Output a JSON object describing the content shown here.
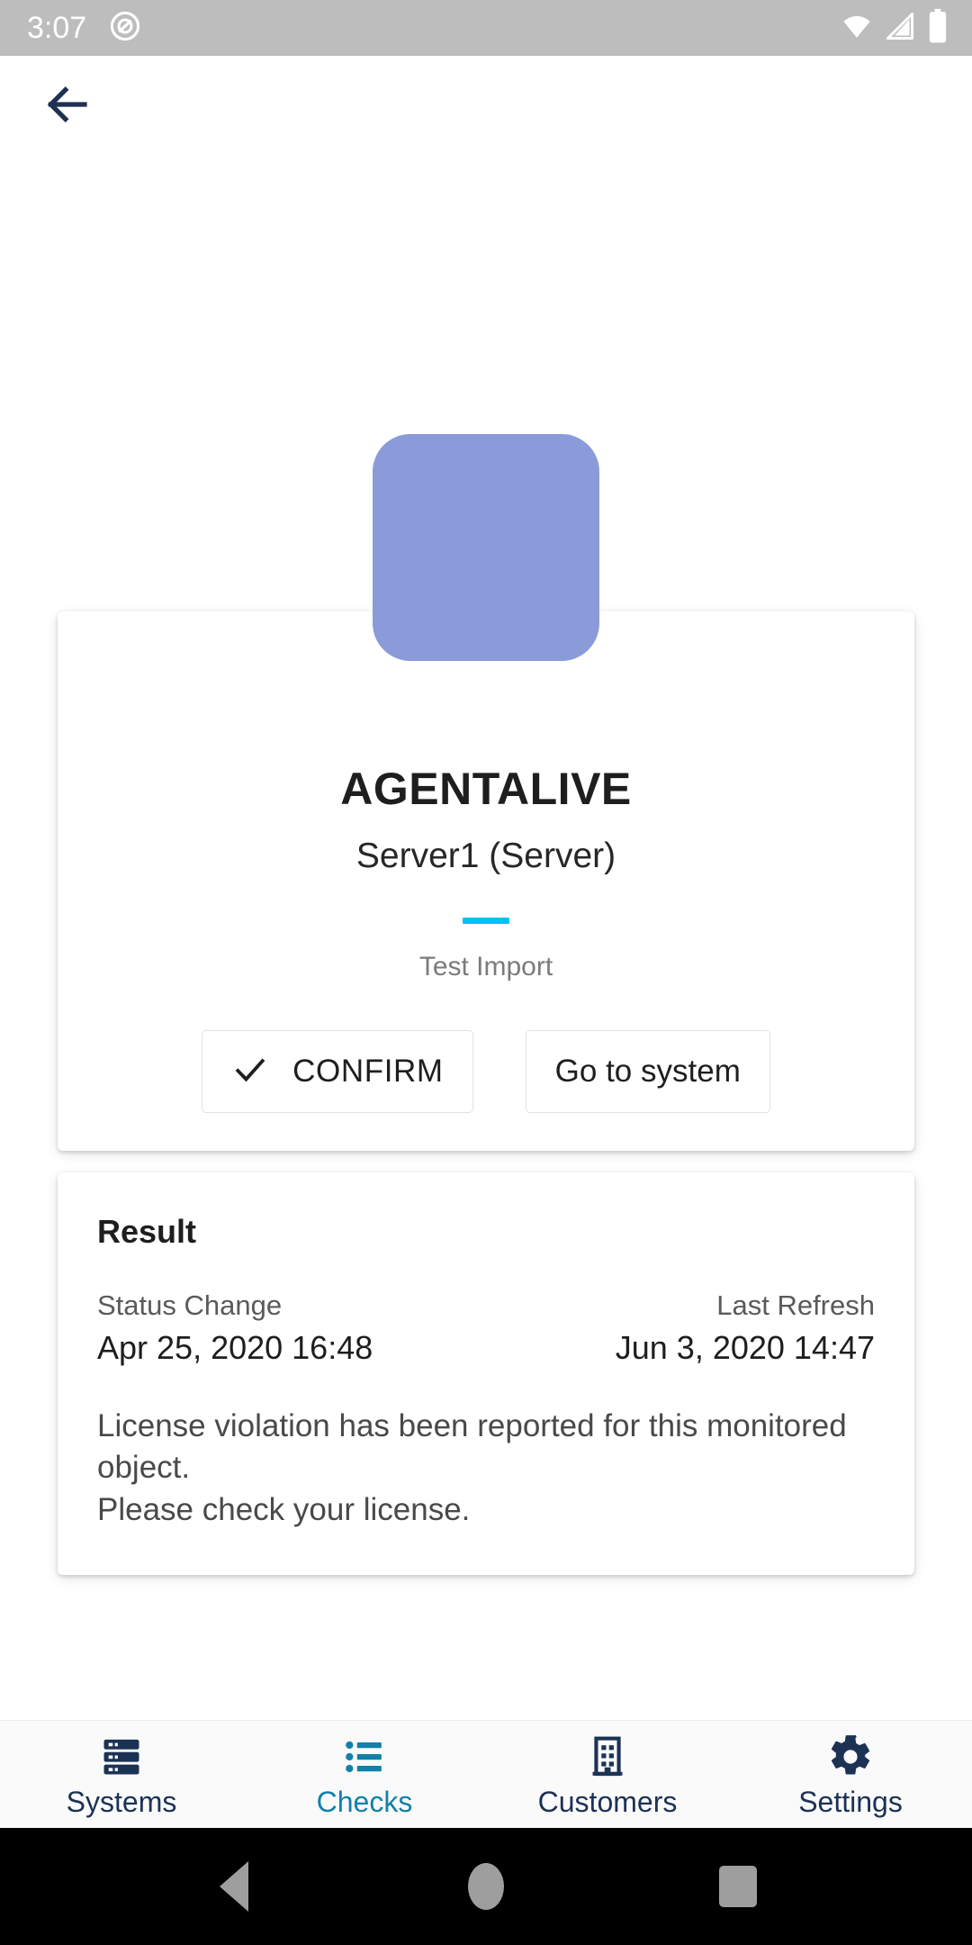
{
  "status_bar": {
    "time": "3:07",
    "icons": [
      "notification-circle-icon",
      "wifi-icon",
      "cellular-signal-icon",
      "battery-icon"
    ],
    "background_color": "#bdbdbd"
  },
  "app_bar": {
    "back_icon": "arrow-left-icon",
    "icon_color": "#1f3051"
  },
  "detail": {
    "avatar_color": "#8b9bd9",
    "system_title": "AGENTALIVE",
    "system_subtitle": "Server1 (Server)",
    "accent_color": "#00c3f0",
    "check_name": "Test Import",
    "buttons": {
      "confirm_label": "CONFIRM",
      "confirm_icon": "check-icon",
      "goto_label": "Go to system"
    }
  },
  "result": {
    "heading": "Result",
    "status_change_label": "Status Change",
    "status_change_value": "Apr 25, 2020 16:48",
    "last_refresh_label": "Last Refresh",
    "last_refresh_value": "Jun 3, 2020 14:47",
    "message": "License violation has been reported for this monitored object.\nPlease check your license."
  },
  "bottom_nav": {
    "active_color": "#1281a9",
    "inactive_color": "#1c3255",
    "items": [
      {
        "label": "Systems",
        "icon": "servers-icon",
        "active": false
      },
      {
        "label": "Checks",
        "icon": "list-icon",
        "active": true
      },
      {
        "label": "Customers",
        "icon": "building-icon",
        "active": false
      },
      {
        "label": "Settings",
        "icon": "gear-icon",
        "active": false
      }
    ]
  },
  "android_nav": {
    "back_icon": "triangle-back-icon",
    "home_icon": "circle-home-icon",
    "recents_icon": "square-recents-icon",
    "background_color": "#000000"
  }
}
